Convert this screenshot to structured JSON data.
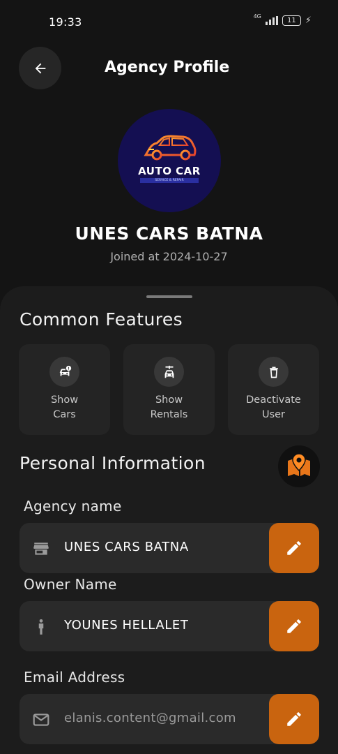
{
  "status_bar": {
    "time": "19:33",
    "network": "4G",
    "battery": "11"
  },
  "header": {
    "title": "Agency Profile",
    "back_icon": "arrow-left-icon"
  },
  "profile": {
    "logo_text": "AUTO CAR",
    "logo_subtext": "SERVICE & REPAIR",
    "name": "UNES CARS BATNA",
    "joined": "Joined at 2024-10-27"
  },
  "common_features": {
    "title": "Common Features",
    "items": [
      {
        "line1": "Show",
        "line2": "Cars",
        "icon": "car-info-icon"
      },
      {
        "line1": "Show",
        "line2": "Rentals",
        "icon": "car-rental-icon"
      },
      {
        "line1": "Deactivate",
        "line2": "User",
        "icon": "trash-icon"
      }
    ]
  },
  "personal_info": {
    "title": "Personal Information",
    "map_icon": "map-pin-icon",
    "fields": [
      {
        "label": "Agency name",
        "value": "UNES CARS BATNA",
        "icon": "store-icon"
      },
      {
        "label": "Owner Name",
        "value": "YOUNES HELLALET",
        "icon": "person-icon"
      },
      {
        "label": "Email Address",
        "value": "elanis.content@gmail.com",
        "icon": "mail-icon"
      }
    ]
  },
  "colors": {
    "accent": "#c9640f",
    "background": "#141414",
    "sheet": "#1c1c1c",
    "logo_bg": "#140f52"
  }
}
